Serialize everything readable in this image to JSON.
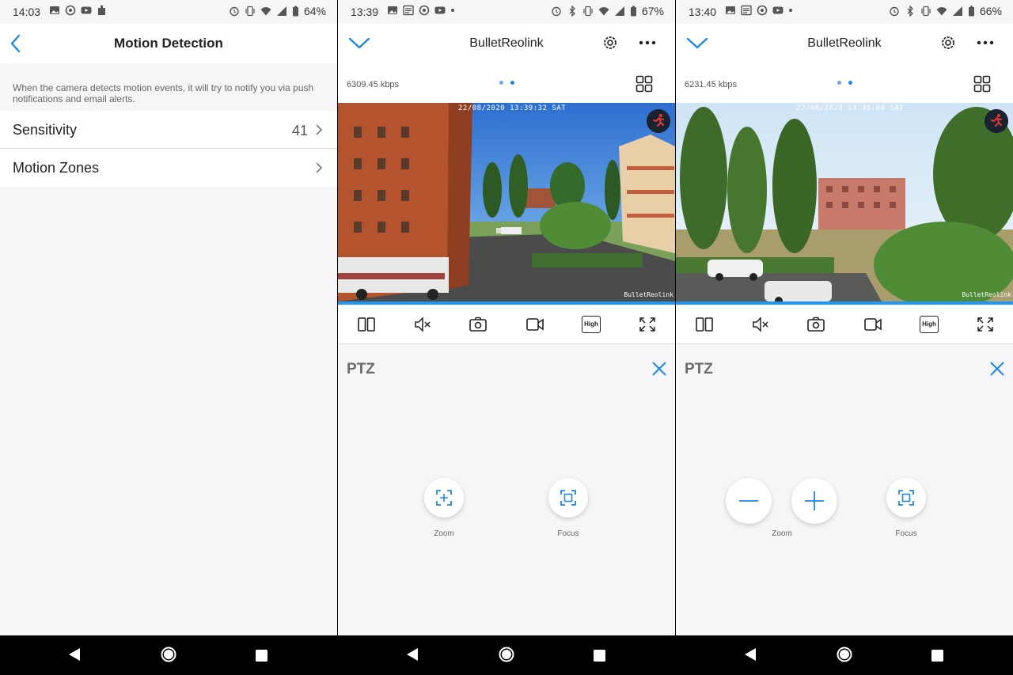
{
  "panel1": {
    "status": {
      "time": "14:03",
      "battery": "64%"
    },
    "header": {
      "title": "Motion Detection"
    },
    "description": "When the camera detects motion events, it will try to notify you via push notifications and email alerts.",
    "items": [
      {
        "label": "Sensitivity",
        "value": "41"
      },
      {
        "label": "Motion Zones",
        "value": ""
      }
    ]
  },
  "panel2": {
    "status": {
      "time": "13:39",
      "battery": "67%"
    },
    "title": "BulletReolink",
    "bitrate": "6309.45 kbps",
    "timestamp": "22/08/2020 13:39:32 SAT",
    "watermark": "BulletReolink",
    "toolbar": {
      "quality": "High"
    },
    "ptz": {
      "label": "PTZ",
      "zoom_label": "Zoom",
      "focus_label": "Focus"
    }
  },
  "panel3": {
    "status": {
      "time": "13:40",
      "battery": "66%"
    },
    "title": "BulletReolink",
    "bitrate": "6231.45 kbps",
    "timestamp": "22/08/2020 13:40:04 SAT",
    "watermark": "BulletReolink",
    "toolbar": {
      "quality": "High"
    },
    "ptz": {
      "label": "PTZ",
      "zoom_label": "Zoom",
      "focus_label": "Focus"
    }
  },
  "colors": {
    "accent": "#1e88e5",
    "background": "#f6f6f8",
    "navbar": "#000000"
  },
  "icons": [
    "back-arrow-icon",
    "chevron-right-icon",
    "chevron-down-icon",
    "gear-icon",
    "more-icon",
    "grid-icon",
    "split-view-icon",
    "mute-icon",
    "camera-icon",
    "record-icon",
    "quality-icon",
    "fullscreen-icon",
    "close-icon",
    "zoom-in-icon",
    "focus-icon",
    "minus-icon",
    "plus-icon",
    "motion-icon"
  ]
}
